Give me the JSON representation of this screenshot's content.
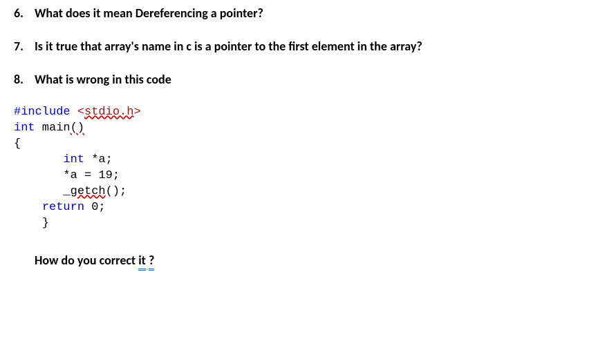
{
  "questions": [
    {
      "num": "6.",
      "text": "What does it mean Dereferencing a pointer?"
    },
    {
      "num": "7.",
      "text": "Is it true that array's name in c is a pointer to the first element in the array?"
    },
    {
      "num": "8.",
      "text": "What is wrong in this code"
    }
  ],
  "code": {
    "include_kw": "#include",
    "include_open": " <",
    "include_file": "stdio.h",
    "include_close": ">",
    "int_kw": "int",
    "main_name": " main",
    "main_parens": "()",
    "brace_open": "{",
    "indent_int": "       int",
    "decl_rest": " *a;",
    "assign_line": "       *a = 19;",
    "blank": "",
    "getch_pre": "       _",
    "getch_name": "getch",
    "getch_post": "();",
    "return_indent": "    ",
    "return_kw": "return",
    "return_val": " 0;",
    "brace_close": "    }"
  },
  "followup": {
    "prefix": "How do you correct ",
    "it": "it",
    "space": " ",
    "qmark": "?"
  }
}
